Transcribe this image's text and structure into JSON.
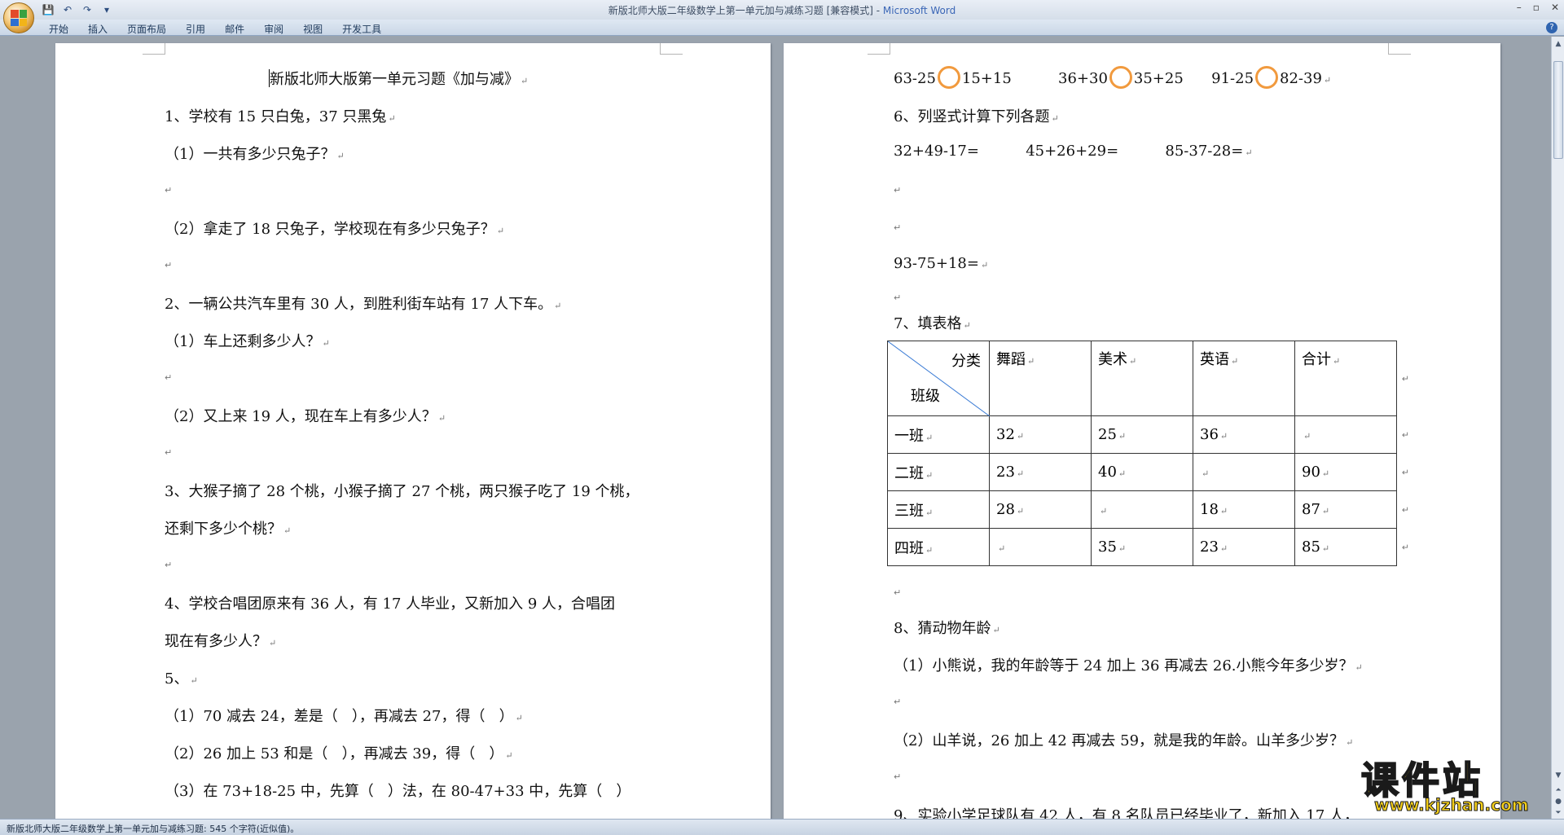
{
  "window": {
    "title": "新版北师大版二年级数学上第一单元加与减练习题 [兼容模式] - ",
    "app_name": "Microsoft Word",
    "controls": [
      "–",
      "▫",
      "✕"
    ]
  },
  "qat": {
    "save": "💾",
    "undo": "↶",
    "redo": "↷",
    "customize": "▾"
  },
  "ribbon": {
    "tabs": [
      "开始",
      "插入",
      "页面布局",
      "引用",
      "邮件",
      "审阅",
      "视图",
      "开发工具"
    ],
    "help": "?"
  },
  "doc": {
    "title": "新版北师大版第一单元习题《加与减》",
    "q1": "1、学校有 15 只白兔，37 只黑兔",
    "q1_1": "（1）一共有多少只兔子？",
    "q1_2": "（2）拿走了 18 只兔子，学校现在有多少只兔子？",
    "q2": "2、一辆公共汽车里有 30 人，到胜利街车站有 17 人下车。",
    "q2_1": "（1）车上还剩多少人？",
    "q2_2": "（2）又上来 19 人，现在车上有多少人？",
    "q3a": "3、大猴子摘了 28 个桃，小猴子摘了 27 个桃，两只猴子吃了 19 个桃，",
    "q3b": "还剩下多少个桃？",
    "q4a": "4、学校合唱团原来有 36 人，有 17 人毕业，又新加入 9 人，合唱团",
    "q4b": "现在有多少人？",
    "q5": "5、",
    "q5_1": "（1）70 减去 24，差是（   ），再减去 27，得（   ）",
    "q5_2": "（2）26 加上 53 和是（   ），再减去 39，得（   ）",
    "q5_3": "（3）在 73+18-25 中，先算（   ）法，在 80-47+33 中，先算（   ）",
    "cmp": [
      {
        "left": "63-25",
        "right": "15+15"
      },
      {
        "left": "36+30",
        "right": "35+25"
      },
      {
        "left": "91-25",
        "right": "82-39"
      }
    ],
    "q6": "6、列竖式计算下列各题",
    "q6_exprs": [
      "32+49-17=",
      "45+26+29=",
      "85-37-28="
    ],
    "q6_expr4": "93-75+18=",
    "q7": "7、填表格",
    "table": {
      "diag_top": "分类",
      "diag_bottom": "班级",
      "headers": [
        "舞蹈",
        "美术",
        "英语",
        "合计"
      ],
      "rows": [
        {
          "name": "一班",
          "cells": [
            "32",
            "25",
            "36",
            ""
          ]
        },
        {
          "name": "二班",
          "cells": [
            "23",
            "40",
            "",
            "90"
          ]
        },
        {
          "name": "三班",
          "cells": [
            "28",
            "",
            "18",
            "87"
          ]
        },
        {
          "name": "四班",
          "cells": [
            "",
            "35",
            "23",
            "85"
          ]
        }
      ]
    },
    "q8": "8、猜动物年龄",
    "q8_1": "（1）小熊说，我的年龄等于 24 加上 36 再减去 26.小熊今年多少岁？",
    "q8_2": "（2）山羊说，26 加上 42 再减去 59，就是我的年龄。山羊多少岁？",
    "q9": "9、实验小学足球队有 42 人，有 8 名队员已经毕业了，新加入 17 人，"
  },
  "para_mark": "↵",
  "status": {
    "text": "新版北师大版二年级数学上第一单元加与减练习题: 545 个字符(近似值)。"
  },
  "watermark": {
    "title": "课件站",
    "url": "www.kjzhan.com"
  },
  "colors": {
    "compare_circle": "#f19a3e",
    "watermark": "#f4cf1a"
  }
}
